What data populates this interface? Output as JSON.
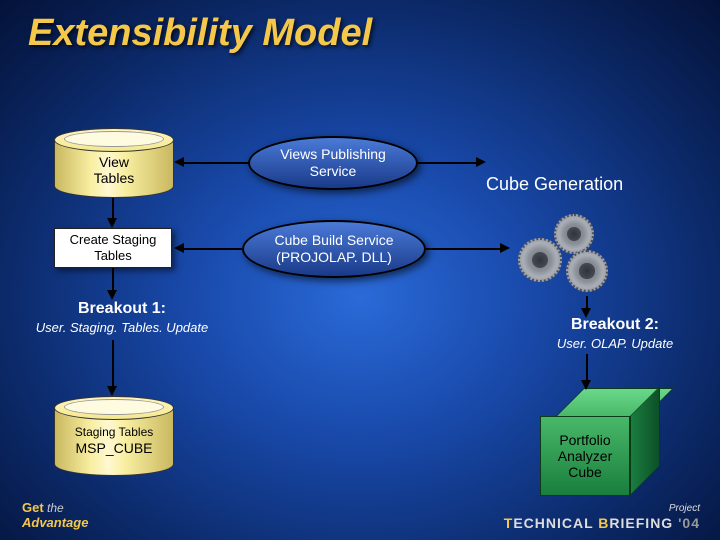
{
  "title": "Extensibility Model",
  "nodes": {
    "view_tables": {
      "line1": "View",
      "line2": "Tables"
    },
    "views_publishing": {
      "line1": "Views Publishing",
      "line2": "Service"
    },
    "create_staging": {
      "line1": "Create Staging",
      "line2": "Tables"
    },
    "cube_build": {
      "line1": "Cube Build Service",
      "line2": "(PROJOLAP. DLL)"
    },
    "staging_cyl": {
      "line1": "Staging Tables",
      "line2": "MSP_CUBE"
    },
    "portfolio_cube": {
      "line1": "Portfolio",
      "line2": "Analyzer",
      "line3": "Cube"
    }
  },
  "labels": {
    "cube_generation": "Cube Generation",
    "breakout1_title": "Breakout 1:",
    "breakout1_sub": "User. Staging. Tables. Update",
    "breakout2_title": "Breakout 2:",
    "breakout2_sub": "User. OLAP. Update"
  },
  "footer": {
    "get": "Get",
    "the": "the",
    "advantage": "Advantage",
    "project": "Project",
    "tb1": "T",
    "tb2": "ECHNICAL",
    "tb3": "B",
    "tb4": "RIEFING",
    "year": "'04"
  }
}
